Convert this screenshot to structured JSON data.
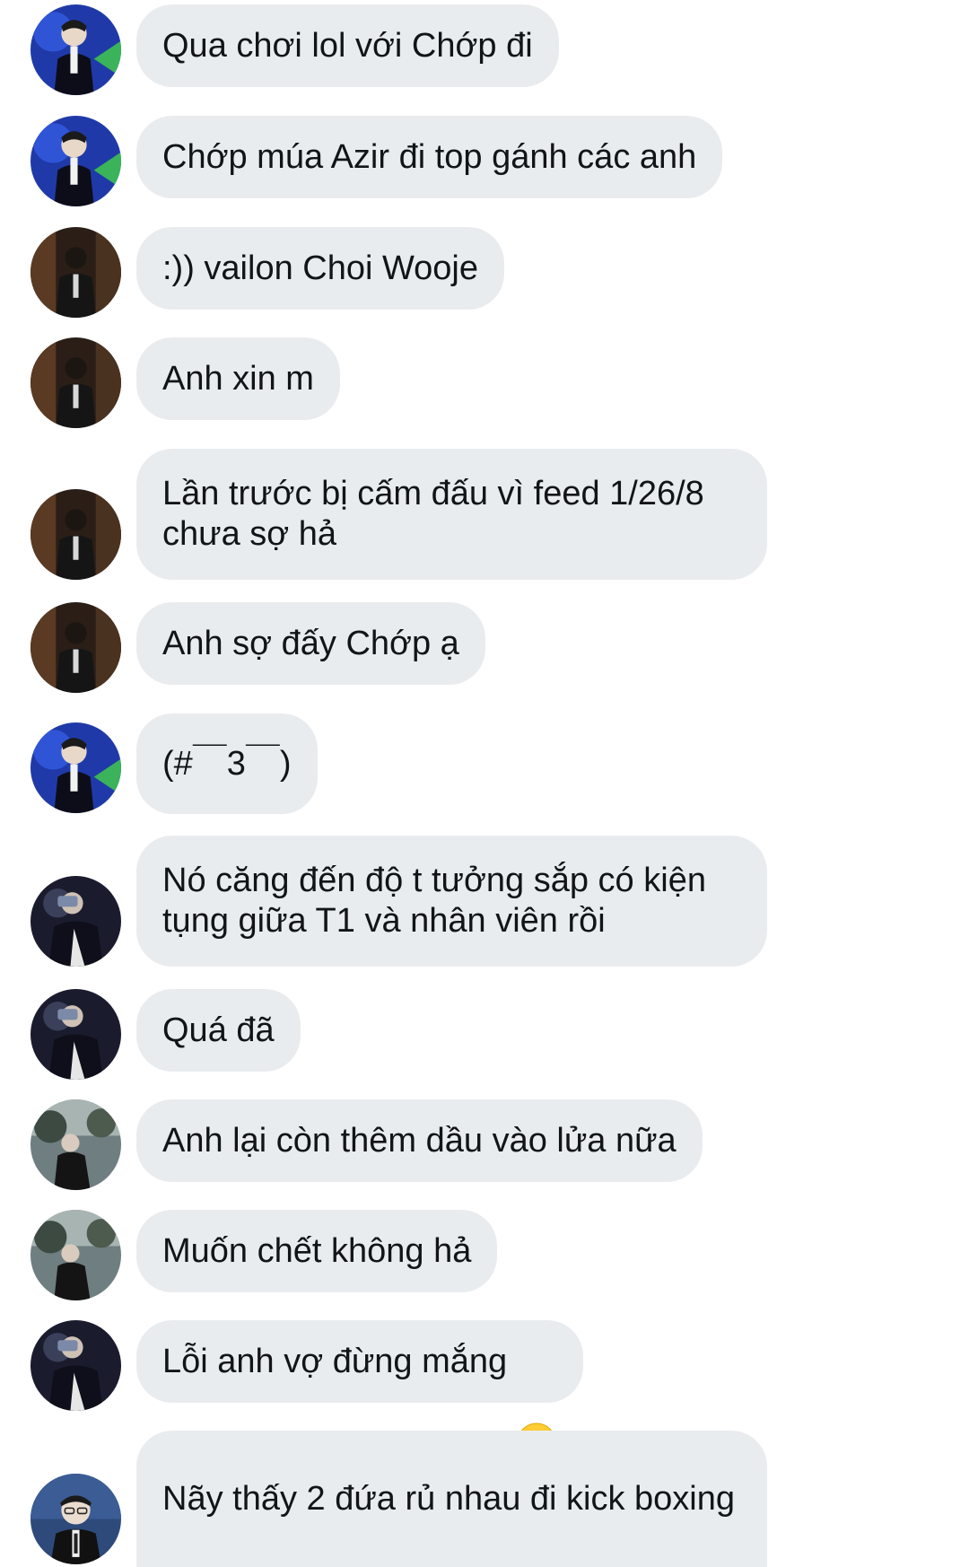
{
  "messages": [
    {
      "avatar": "avatar-performer",
      "text": "Qua chơi lol với Chớp đi"
    },
    {
      "avatar": "avatar-performer",
      "text": "Chớp múa Azir đi top gánh các anh"
    },
    {
      "avatar": "avatar-suit-dark",
      "text": ":)) vailon Choi Wooje"
    },
    {
      "avatar": "avatar-suit-dark",
      "text": "Anh xin m"
    },
    {
      "avatar": "avatar-suit-dark",
      "text": "Lần trước bị cấm đấu vì feed 1/26/8 chưa sợ hả"
    },
    {
      "avatar": "avatar-suit-dark",
      "text": "Anh sợ đấy Chớp ạ"
    },
    {
      "avatar": "avatar-performer",
      "text": "(#￣3￣)"
    },
    {
      "avatar": "avatar-drinking",
      "text": "Nó căng đến độ t tưởng sắp có kiện tụng giữa T1 và nhân viên rồi"
    },
    {
      "avatar": "avatar-drinking",
      "text": "Quá đã"
    },
    {
      "avatar": "avatar-outdoor",
      "text": "Anh lại còn thêm dầu vào lửa nữa"
    },
    {
      "avatar": "avatar-outdoor",
      "text": "Muốn chết không hả"
    },
    {
      "avatar": "avatar-drinking",
      "text": "Lỗi anh vợ đừng mắng",
      "emoji": "crying-face-emoji"
    },
    {
      "avatar": "avatar-glasses",
      "text": "Nãy thấy 2 đứa rủ nhau đi kick boxing"
    }
  ],
  "colors": {
    "bubble": "#e9ecef",
    "text": "#111418",
    "background": "#ffffff"
  }
}
